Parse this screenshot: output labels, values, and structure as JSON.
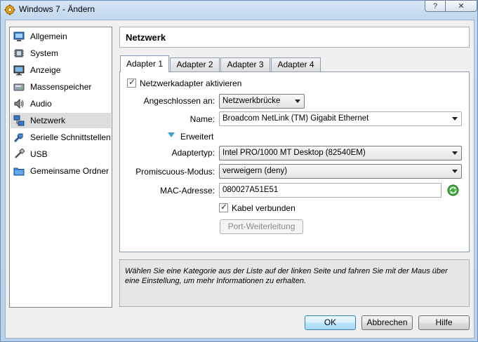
{
  "window": {
    "title": "Windows 7 - Ändern",
    "help_label": "?",
    "close_label": "✕"
  },
  "sidebar": {
    "items": [
      {
        "label": "Allgemein",
        "icon": "general-icon"
      },
      {
        "label": "System",
        "icon": "system-icon"
      },
      {
        "label": "Anzeige",
        "icon": "display-icon"
      },
      {
        "label": "Massenspeicher",
        "icon": "storage-icon"
      },
      {
        "label": "Audio",
        "icon": "audio-icon"
      },
      {
        "label": "Netzwerk",
        "icon": "network-icon",
        "selected": true
      },
      {
        "label": "Serielle Schnittstellen",
        "icon": "serial-port-icon"
      },
      {
        "label": "USB",
        "icon": "usb-icon"
      },
      {
        "label": "Gemeinsame Ordner",
        "icon": "shared-folder-icon"
      }
    ]
  },
  "header": {
    "title": "Netzwerk"
  },
  "tabs": [
    {
      "label": "Adapter 1",
      "active": true
    },
    {
      "label": "Adapter 2"
    },
    {
      "label": "Adapter 3"
    },
    {
      "label": "Adapter 4"
    }
  ],
  "adapter": {
    "enable_label": "Netzwerkadapter aktivieren",
    "attached_label": "Angeschlossen an:",
    "attached_value": "Netzwerkbrücke",
    "name_label": "Name:",
    "name_value": "Broadcom NetLink (TM) Gigabit Ethernet",
    "advanced_label": "Erweitert",
    "type_label": "Adaptertyp:",
    "type_value": "Intel PRO/1000 MT Desktop (82540EM)",
    "promisc_label": "Promiscuous-Modus:",
    "promisc_value": "verweigern (deny)",
    "mac_label": "MAC-Adresse:",
    "mac_value": "080027A51E51",
    "cable_label": "Kabel verbunden",
    "port_forward_label": "Port-Weiterleitung"
  },
  "info": {
    "text": "Wählen Sie eine Kategorie aus der Liste auf der linken Seite und fahren Sie mit der Maus über eine Einstellung, um mehr Informationen zu erhalten."
  },
  "buttons": {
    "ok": "OK",
    "cancel": "Abbrechen",
    "help": "Hilfe"
  },
  "colors": {
    "accent": "#3aa0d8",
    "selection": "#dcdcdc"
  }
}
